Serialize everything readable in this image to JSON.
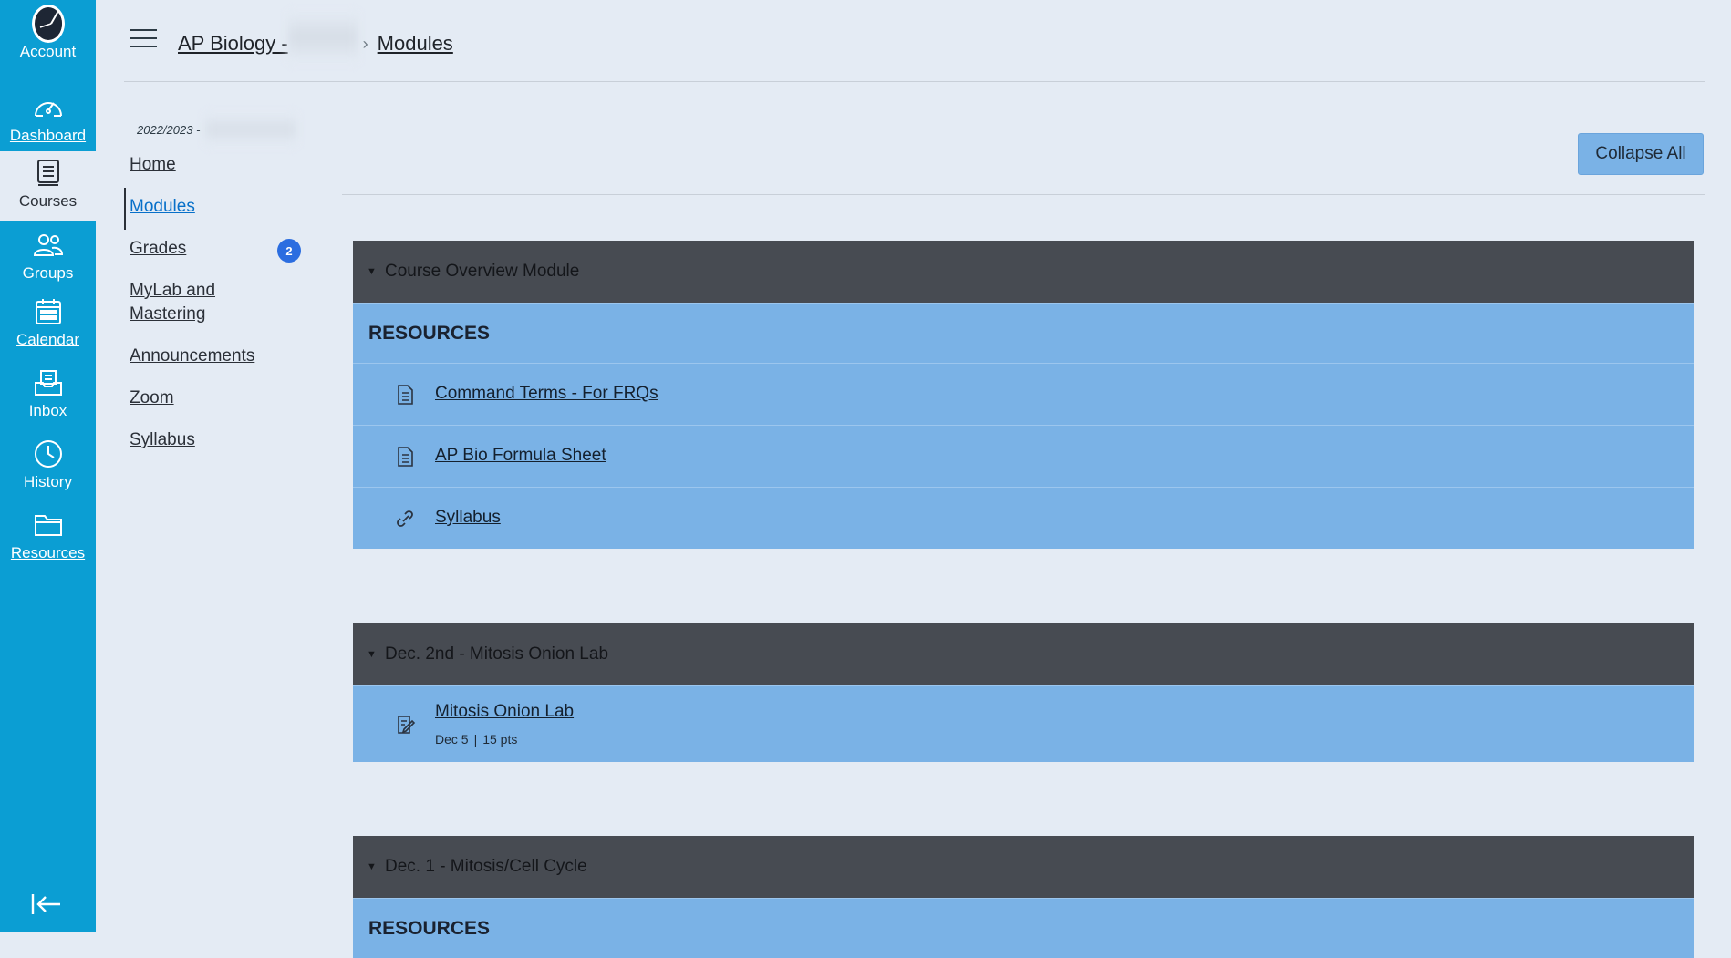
{
  "global_nav": {
    "items": [
      {
        "label": "Account",
        "icon": "account-avatar-icon"
      },
      {
        "label": "Dashboard",
        "icon": "dashboard-icon"
      },
      {
        "label": "Courses",
        "icon": "courses-icon"
      },
      {
        "label": "Groups",
        "icon": "groups-icon"
      },
      {
        "label": "Calendar",
        "icon": "calendar-icon"
      },
      {
        "label": "Inbox",
        "icon": "inbox-icon"
      },
      {
        "label": "History",
        "icon": "history-icon"
      },
      {
        "label": "Resources",
        "icon": "folder-icon"
      }
    ],
    "active": "Courses",
    "color": "#0b9ed3"
  },
  "breadcrumb": {
    "course": "AP Biology -",
    "current": "Modules"
  },
  "course_nav": {
    "term": "2022/2023 -",
    "items": [
      {
        "label": "Home"
      },
      {
        "label": "Modules"
      },
      {
        "label": "Grades",
        "badge": "2"
      },
      {
        "label": "MyLab and Mastering"
      },
      {
        "label": "Announcements"
      },
      {
        "label": "Zoom"
      },
      {
        "label": "Syllabus"
      }
    ],
    "active": "Modules"
  },
  "toolbar": {
    "collapse_all": "Collapse All"
  },
  "modules": [
    {
      "title": "Course Overview Module",
      "subheader": "RESOURCES",
      "items": [
        {
          "title": "Command Terms - For FRQs",
          "type": "page"
        },
        {
          "title": "AP Bio Formula Sheet",
          "type": "page"
        },
        {
          "title": "Syllabus",
          "type": "link"
        }
      ]
    },
    {
      "title": "Dec. 2nd - Mitosis Onion Lab",
      "items": [
        {
          "title": "Mitosis Onion Lab",
          "type": "assignment",
          "due": "Dec 5",
          "points": "15 pts"
        }
      ]
    },
    {
      "title": "Dec. 1 - Mitosis/Cell Cycle",
      "subheader": "RESOURCES"
    }
  ],
  "colors": {
    "module_header": "#474b52",
    "module_row": "#7ab2e6",
    "background": "#e4ebf4",
    "badge": "#2b6de0"
  }
}
